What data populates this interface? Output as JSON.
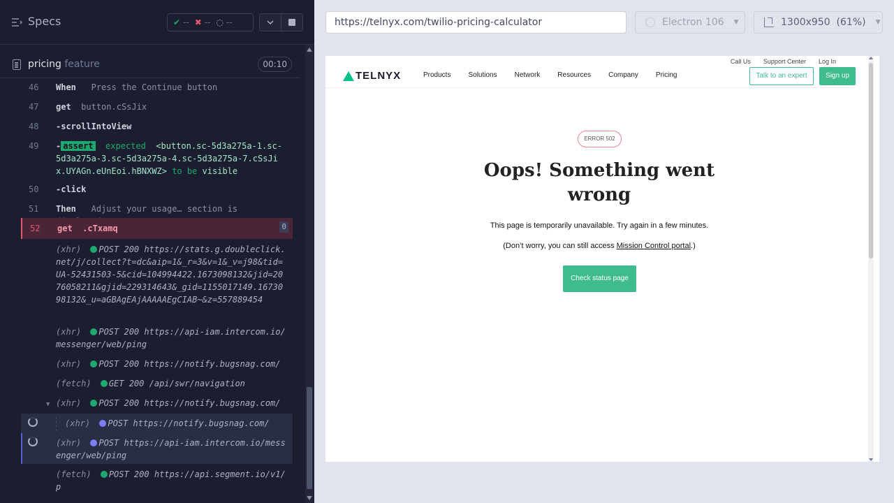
{
  "reporter": {
    "title": "Specs",
    "stats": {
      "passed": "--",
      "failed": "--",
      "pending": "--"
    },
    "spec": {
      "name": "pricing",
      "ext": "feature",
      "duration": "00:10"
    }
  },
  "commands": [
    {
      "num": "46",
      "kw": "When",
      "text": "Press the Continue button"
    },
    {
      "num": "47",
      "kw": "get",
      "text": "button.cSsJix"
    },
    {
      "num": "48",
      "kw": "-scrollIntoView",
      "text": ""
    },
    {
      "num": "49",
      "kw": "-",
      "badge": "assert",
      "text1": "expected",
      "text2": "<button.sc-5d3a275a-1.sc-5d3a275a-3.sc-5d3a275a-4.sc-5d3a275a-7.cSsJix.UYAGn.eUnEoi.hBNXWZ>",
      "text3": "to be",
      "text4": "visible"
    },
    {
      "num": "50",
      "kw": "-click",
      "text": ""
    },
    {
      "num": "51",
      "kw": "Then",
      "text": "Adjust your usage… section is displayed"
    },
    {
      "num": "52",
      "kw": "get",
      "text": ".cTxamq",
      "count": "0"
    }
  ],
  "requests": [
    {
      "type": "(xhr)",
      "status": "POST 200",
      "url": "https://stats.g.doubleclick.net/j/collect?t=dc&aip=1&_r=3&v=1&_v=j98&tid=UA-52431503-5&cid=104994422.1673098132&jid=2076058211&gjid=229314643&_gid=1155017149.1673098132&_u=aGBAgEAjAAAAAEgCIAB~&z=557889454"
    },
    {
      "type": "(xhr)",
      "status": "POST 200",
      "url": "https://api-iam.intercom.io/messenger/web/ping"
    },
    {
      "type": "(xhr)",
      "status": "POST 200",
      "url": "https://notify.bugsnag.com/"
    },
    {
      "type": "(fetch)",
      "status": "GET 200",
      "url": "/api/swr/navigation"
    },
    {
      "type": "(xhr)",
      "status": "POST 200",
      "url": "https://notify.bugsnag.com/"
    },
    {
      "type": "(xhr)",
      "status": "POST",
      "url": "https://notify.bugsnag.com/"
    },
    {
      "type": "(xhr)",
      "status": "POST",
      "url": "https://api-iam.intercom.io/messenger/web/ping"
    },
    {
      "type": "(fetch)",
      "status": "POST 200",
      "url": "https://api.segment.io/v1/p"
    }
  ],
  "aut": {
    "url": "https://telnyx.com/twilio-pricing-calculator",
    "browser": "Electron 106",
    "viewport": "1300x950",
    "scale": "(61%)"
  },
  "site": {
    "util_nav": [
      "Call Us",
      "Support Center",
      "Log In"
    ],
    "logo": "TELNYX",
    "nav": [
      "Products",
      "Solutions",
      "Network",
      "Resources",
      "Company",
      "Pricing"
    ],
    "talk_btn": "Talk to an expert",
    "signup_btn": "Sign up",
    "error_badge": "ERROR 502",
    "error_title": "Oops! Something went wrong",
    "error_msg": "This page is temporarily unavailable. Try again in a few minutes.",
    "error_msg2_pre": "(Don’t worry, you can still access ",
    "error_msg2_link": "Mission Control portal",
    "error_msg2_post": ".)",
    "status_btn": "Check status page"
  },
  "colors": {
    "success": "#1fa971",
    "error": "#e45770",
    "brand": "#3fbc8e",
    "pending": "#7b7df5"
  }
}
